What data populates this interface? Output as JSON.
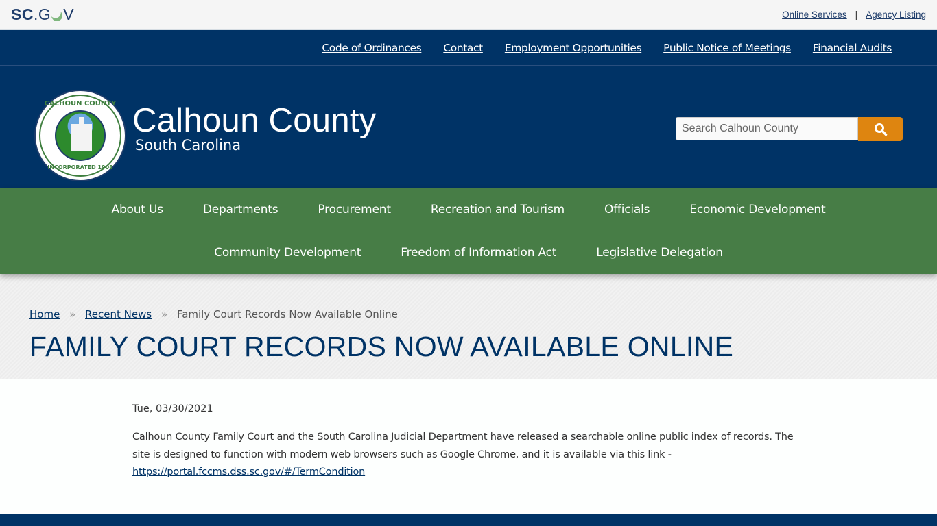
{
  "utility": {
    "logo": {
      "sc": "SC",
      "dot": ".",
      "g": "G",
      "v": "V"
    },
    "links": [
      "Online Services",
      "Agency Listing"
    ],
    "separator": "|"
  },
  "secondary_nav": {
    "items": [
      "Code of Ordinances",
      "Contact",
      "Employment Opportunities",
      "Public Notice of Meetings",
      "Financial Audits"
    ]
  },
  "header": {
    "seal": {
      "top_text": "CALHOUN COUNTY",
      "bottom_text": "INCORPORATED 1908"
    },
    "site_name": "Calhoun County",
    "site_state": "South Carolina",
    "search": {
      "placeholder": "Search Calhoun County",
      "button_icon": "search-icon"
    },
    "accent_color": "#de8510"
  },
  "main_nav": {
    "row1": [
      "About Us",
      "Departments",
      "Procurement",
      "Recreation and Tourism",
      "Officials",
      "Economic Development"
    ],
    "row2": [
      "Community Development",
      "Freedom of Information Act",
      "Legislative Delegation"
    ]
  },
  "breadcrumb": {
    "items": [
      "Home",
      "Recent News"
    ],
    "current": "Family Court Records Now Available Online",
    "separator": "»"
  },
  "page": {
    "title": "FAMILY COURT RECORDS NOW AVAILABLE ONLINE",
    "date": "Tue, 03/30/2021",
    "body_text": "Calhoun County Family Court and the South Carolina Judicial Department have released a searchable online public index of records. The site is designed to function with modern web browsers such as Google Chrome, and it is available via this link - ",
    "link": "https://portal.fccms.dss.sc.gov/#/TermCondition"
  },
  "colors": {
    "navy": "#003366",
    "green": "#477d46",
    "orange": "#de8510"
  }
}
